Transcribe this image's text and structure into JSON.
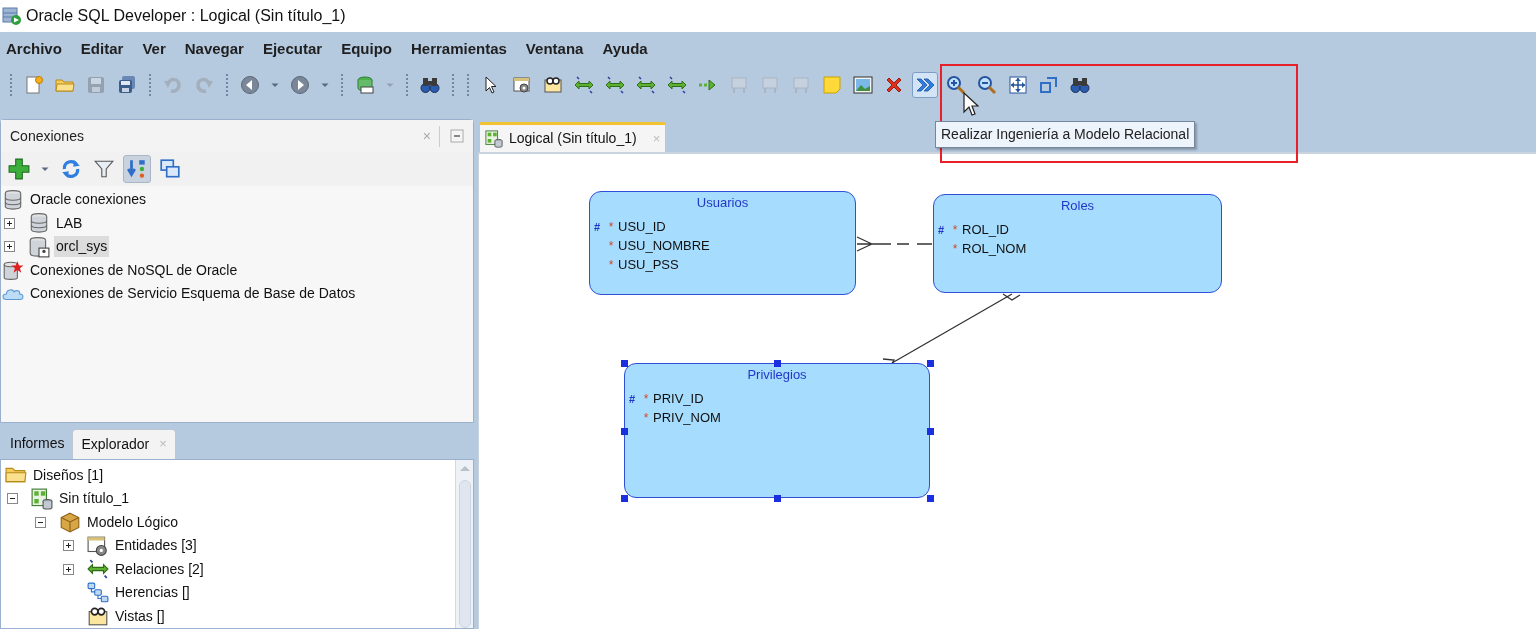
{
  "window": {
    "title": "Oracle SQL Developer : Logical (Sin título_1)"
  },
  "menu": [
    "Archivo",
    "Editar",
    "Ver",
    "Navegar",
    "Ejecutar",
    "Equipo",
    "Herramientas",
    "Ventana",
    "Ayuda"
  ],
  "toolbar": [
    {
      "kind": "separator"
    },
    {
      "kind": "new",
      "disabled": false,
      "highlighted": false
    },
    {
      "kind": "open",
      "disabled": false,
      "highlighted": false
    },
    {
      "kind": "save",
      "disabled": true,
      "highlighted": false
    },
    {
      "kind": "save_all",
      "disabled": false,
      "highlighted": false
    },
    {
      "kind": "separator"
    },
    {
      "kind": "undo",
      "disabled": true,
      "highlighted": false
    },
    {
      "kind": "redo",
      "disabled": true,
      "highlighted": false
    },
    {
      "kind": "separator"
    },
    {
      "kind": "back",
      "disabled": false,
      "highlighted": false
    },
    {
      "kind": "caret",
      "disabled": false,
      "highlighted": false
    },
    {
      "kind": "forward",
      "disabled": false,
      "highlighted": false
    },
    {
      "kind": "caret",
      "disabled": false,
      "highlighted": false
    },
    {
      "kind": "separator"
    },
    {
      "kind": "sql",
      "disabled": false,
      "highlighted": false
    },
    {
      "kind": "caret",
      "disabled": true,
      "highlighted": false
    },
    {
      "kind": "separator"
    },
    {
      "kind": "binoculars",
      "disabled": false,
      "highlighted": false
    },
    {
      "kind": "separator"
    },
    {
      "kind": "separator"
    },
    {
      "kind": "pointer",
      "disabled": false,
      "highlighted": false
    },
    {
      "kind": "entity",
      "disabled": false,
      "highlighted": false
    },
    {
      "kind": "view",
      "disabled": false,
      "highlighted": false
    },
    {
      "kind": "relation",
      "disabled": false,
      "highlighted": false
    },
    {
      "kind": "relation",
      "disabled": false,
      "highlighted": false
    },
    {
      "kind": "relation",
      "disabled": false,
      "highlighted": false
    },
    {
      "kind": "relation",
      "disabled": false,
      "highlighted": false
    },
    {
      "kind": "arrow",
      "disabled": false,
      "highlighted": false
    },
    {
      "kind": "table",
      "disabled": true,
      "highlighted": false
    },
    {
      "kind": "table",
      "disabled": true,
      "highlighted": false
    },
    {
      "kind": "table",
      "disabled": true,
      "highlighted": false
    },
    {
      "kind": "note",
      "disabled": false,
      "highlighted": false
    },
    {
      "kind": "picture",
      "disabled": false,
      "highlighted": false
    },
    {
      "kind": "delete",
      "disabled": false,
      "highlighted": false
    },
    {
      "kind": "engineer",
      "disabled": false,
      "highlighted": true
    },
    {
      "kind": "zoom_in",
      "disabled": false,
      "highlighted": false
    },
    {
      "kind": "zoom_out",
      "disabled": false,
      "highlighted": false
    },
    {
      "kind": "fit",
      "disabled": false,
      "highlighted": false
    },
    {
      "kind": "resize",
      "disabled": false,
      "highlighted": false
    },
    {
      "kind": "binoculars",
      "disabled": false,
      "highlighted": false
    }
  ],
  "tooltip": "Realizar Ingeniería a Modelo Relacional",
  "connections_panel": {
    "title": "Conexiones",
    "close": "×",
    "toolbar": [
      {
        "kind": "add",
        "selected": false
      },
      {
        "kind": "caret",
        "selected": false
      },
      {
        "kind": "refresh",
        "selected": false
      },
      {
        "kind": "filter",
        "selected": false
      },
      {
        "kind": "sort",
        "selected": true
      },
      {
        "kind": "windows",
        "selected": false
      }
    ],
    "tree": [
      {
        "kind": "database",
        "label": "Oracle conexiones",
        "selected": false,
        "children": [
          {
            "kind": "database",
            "label": "LAB",
            "expanded": false,
            "selected": false
          },
          {
            "kind": "database_user",
            "label": "orcl_sys",
            "expanded": false,
            "selected": true
          }
        ]
      },
      {
        "kind": "nosql",
        "label": "Conexiones de NoSQL de Oracle",
        "selected": false
      },
      {
        "kind": "cloud",
        "label": "Conexiones de Servicio Esquema de Base de Datos",
        "selected": false
      }
    ]
  },
  "lower_panel": {
    "tabs": [
      {
        "label": "Informes",
        "selected": false
      },
      {
        "label": "Explorador",
        "selected": true,
        "close": "×"
      }
    ],
    "tree": [
      {
        "kind": "folder",
        "label": "Diseños [1]",
        "selected": false,
        "children": [
          {
            "kind": "design",
            "label": "Sin título_1",
            "expanded": true,
            "selected": false,
            "children": [
              {
                "kind": "model",
                "label": "Modelo Lógico",
                "expanded": true,
                "selected": false,
                "children": [
                  {
                    "kind": "entities",
                    "label": "Entidades [3]",
                    "expanded": false,
                    "selected": false
                  },
                  {
                    "kind": "relations",
                    "label": "Relaciones [2]",
                    "expanded": false,
                    "selected": false
                  },
                  {
                    "kind": "inheritance",
                    "label": "Herencias []",
                    "selected": false
                  },
                  {
                    "kind": "views",
                    "label": "Vistas []",
                    "selected": false
                  }
                ]
              }
            ]
          }
        ]
      }
    ]
  },
  "editor": {
    "tabs": [
      {
        "label": "Logical (Sin título_1)",
        "selected": true,
        "close": "×"
      }
    ],
    "entities": [
      {
        "name": "Usuarios",
        "selected": false,
        "attributes": [
          {
            "key_mark": "#",
            "required_mark": "*",
            "name": "USU_ID"
          },
          {
            "required_mark": "*",
            "name": "USU_NOMBRE"
          },
          {
            "required_mark": "*",
            "name": "USU_PSS"
          }
        ]
      },
      {
        "name": "Roles",
        "selected": false,
        "attributes": [
          {
            "key_mark": "#",
            "required_mark": "*",
            "name": "ROL_ID"
          },
          {
            "required_mark": "*",
            "name": "ROL_NOM"
          }
        ]
      },
      {
        "name": "Privilegios",
        "selected": true,
        "attributes": [
          {
            "key_mark": "#",
            "required_mark": "*",
            "name": "PRIV_ID"
          },
          {
            "required_mark": "*",
            "name": "PRIV_NOM"
          }
        ]
      }
    ]
  }
}
